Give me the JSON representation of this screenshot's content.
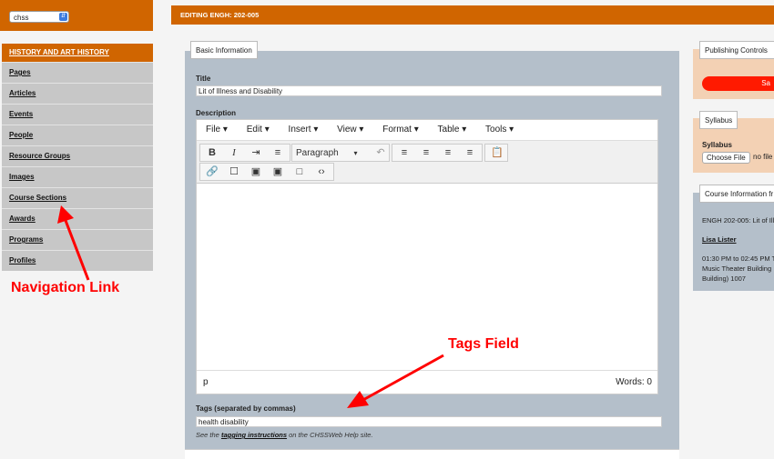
{
  "site_select": {
    "value": "chss"
  },
  "nav": {
    "heading": "HISTORY AND ART HISTORY",
    "items": [
      {
        "label": "Pages"
      },
      {
        "label": "Articles"
      },
      {
        "label": "Events"
      },
      {
        "label": "People"
      },
      {
        "label": "Resource Groups"
      },
      {
        "label": "Images"
      },
      {
        "label": "Course Sections"
      },
      {
        "label": "Awards"
      },
      {
        "label": "Programs"
      },
      {
        "label": "Profiles"
      }
    ]
  },
  "annotations": {
    "navigation_link": "Navigation Link",
    "tags_field": "Tags Field",
    "color": "#ff0000"
  },
  "main": {
    "header": "EDITING ENGH: 202-005",
    "tab": "Basic Information",
    "title_label": "Title",
    "title_value": "Lit of Illness and Disability",
    "description_label": "Description",
    "editor": {
      "menu": [
        "File",
        "Edit",
        "Insert",
        "View",
        "Format",
        "Table",
        "Tools"
      ],
      "format_select": "Paragraph",
      "status_path": "p",
      "word_count": "Words: 0"
    },
    "tags_label": "Tags (separated by commas)",
    "tags_value": "health disability",
    "help_prefix": "See the ",
    "help_link": "tagging instructions",
    "help_suffix": " on the CHSSWeb Help site."
  },
  "right": {
    "publishing_tab": "Publishing Controls",
    "save_label": "Sa",
    "syllabus_tab": "Syllabus",
    "syllabus_label": "Syllabus",
    "choose_file": "Choose File",
    "no_file": "no file",
    "course_info_tab": "Course Information fr",
    "course_line": "ENGH 202-005: Lit of Ill",
    "instructor": "Lisa Lister",
    "time_line1": "01:30 PM to 02:45 PM T",
    "time_line2": "Music Theater Building",
    "time_line3": "Building) 1007"
  },
  "colors": {
    "accent": "#d06500",
    "nav_bg": "#c7c7c7",
    "panel": "#b4bfca",
    "save": "#ff1a00"
  }
}
